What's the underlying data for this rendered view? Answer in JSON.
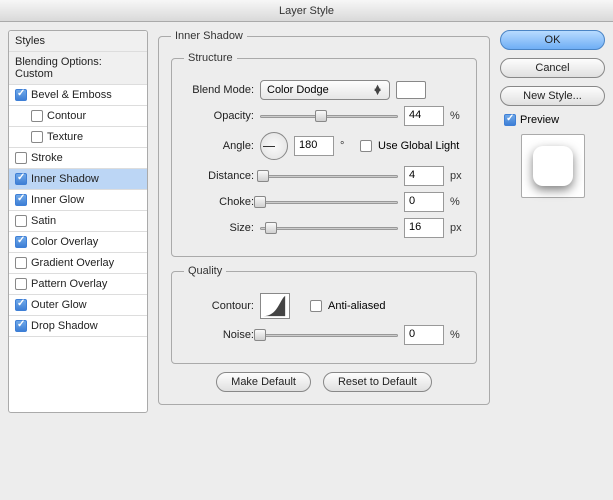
{
  "window": {
    "title": "Layer Style"
  },
  "sidebar": {
    "styles_header": "Styles",
    "blending_options": "Blending Options: Custom",
    "items": [
      {
        "label": "Bevel & Emboss",
        "checked": true,
        "indent": false
      },
      {
        "label": "Contour",
        "checked": false,
        "indent": true
      },
      {
        "label": "Texture",
        "checked": false,
        "indent": true
      },
      {
        "label": "Stroke",
        "checked": false,
        "indent": false
      },
      {
        "label": "Inner Shadow",
        "checked": true,
        "indent": false,
        "selected": true
      },
      {
        "label": "Inner Glow",
        "checked": true,
        "indent": false
      },
      {
        "label": "Satin",
        "checked": false,
        "indent": false
      },
      {
        "label": "Color Overlay",
        "checked": true,
        "indent": false
      },
      {
        "label": "Gradient Overlay",
        "checked": false,
        "indent": false
      },
      {
        "label": "Pattern Overlay",
        "checked": false,
        "indent": false
      },
      {
        "label": "Outer Glow",
        "checked": true,
        "indent": false
      },
      {
        "label": "Drop Shadow",
        "checked": true,
        "indent": false
      }
    ]
  },
  "panel": {
    "title": "Inner Shadow",
    "structure": {
      "legend": "Structure",
      "blend_mode_label": "Blend Mode:",
      "blend_mode_value": "Color Dodge",
      "opacity_label": "Opacity:",
      "opacity_value": "44",
      "opacity_unit": "%",
      "angle_label": "Angle:",
      "angle_value": "180",
      "angle_unit": "°",
      "use_global_light_label": "Use Global Light",
      "use_global_light_checked": false,
      "distance_label": "Distance:",
      "distance_value": "4",
      "distance_unit": "px",
      "choke_label": "Choke:",
      "choke_value": "0",
      "choke_unit": "%",
      "size_label": "Size:",
      "size_value": "16",
      "size_unit": "px"
    },
    "quality": {
      "legend": "Quality",
      "contour_label": "Contour:",
      "anti_aliased_label": "Anti-aliased",
      "anti_aliased_checked": false,
      "noise_label": "Noise:",
      "noise_value": "0",
      "noise_unit": "%"
    },
    "make_default": "Make Default",
    "reset_default": "Reset to Default"
  },
  "buttons": {
    "ok": "OK",
    "cancel": "Cancel",
    "new_style": "New Style...",
    "preview_label": "Preview",
    "preview_checked": true
  }
}
